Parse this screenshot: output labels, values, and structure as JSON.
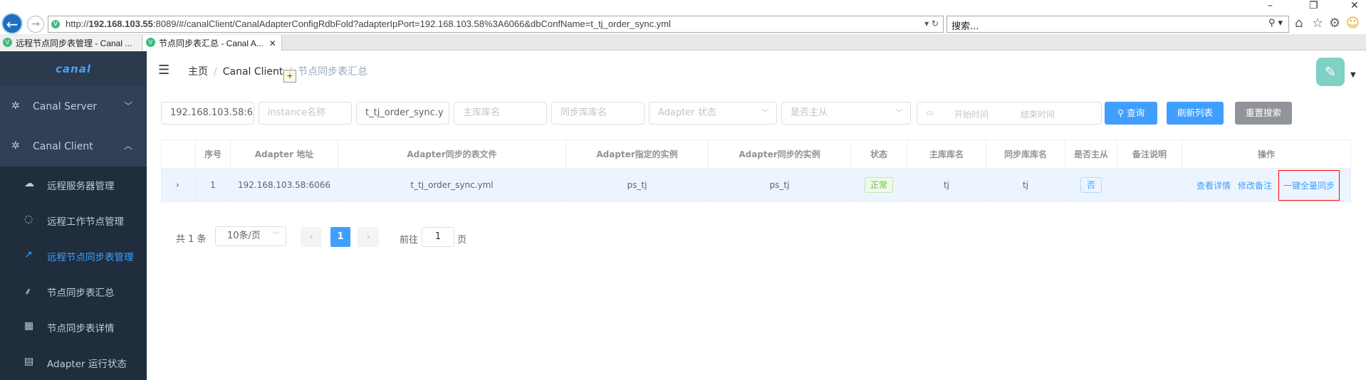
{
  "browser": {
    "url_prefix": "http://",
    "url_host": "192.168.103.55",
    "url_rest": ":8089/#/canalClient/CanalAdapterConfigRdbFold?adapterIpPort=192.168.103.58%3A6066&dbConfName=t_tj_order_sync.yml",
    "search_placeholder": "搜索...",
    "tabs": [
      {
        "label": "远程节点同步表管理 - Canal ..."
      },
      {
        "label": "节点同步表汇总 - Canal A..."
      }
    ]
  },
  "sidebar": {
    "logo": "canal",
    "menus": [
      {
        "label": "Canal Server",
        "icon": "gear-icon"
      },
      {
        "label": "Canal Client",
        "icon": "gear-icon"
      }
    ],
    "items": [
      {
        "label": "远程服务器管理",
        "icon": "cloud-icon"
      },
      {
        "label": "远程工作节点管理",
        "icon": "chat-icon"
      },
      {
        "label": "远程节点同步表管理",
        "icon": "external-link-icon"
      },
      {
        "label": "节点同步表汇总",
        "icon": "tree-icon"
      },
      {
        "label": "节点同步表详情",
        "icon": "table-icon"
      },
      {
        "label": "Adapter 运行状态",
        "icon": "document-icon"
      }
    ]
  },
  "header": {
    "breadcrumb": [
      "主页",
      "Canal Client",
      "节点同步表汇总"
    ]
  },
  "filters": {
    "adapter_ip": "192.168.103.58:6",
    "instance_ph": "instance名称",
    "conf_file": "t_tj_order_sync.y",
    "master_db_ph": "主库库名",
    "sync_db_ph": "同步库库名",
    "status_ph": "Adapter 状态",
    "is_master_ph": "是否主从",
    "start_ph": "开始时间",
    "end_ph": "结束时间",
    "query_btn": "查询",
    "refresh_btn": "刷新列表",
    "reset_btn": "重置搜索"
  },
  "table": {
    "headers": [
      "",
      "序号",
      "Adapter 地址",
      "Adapter同步的表文件",
      "Adapter指定的实例",
      "Adapter同步的实例",
      "状态",
      "主库库名",
      "同步库库名",
      "是否主从",
      "备注说明",
      "操作"
    ],
    "rows": [
      {
        "index": "1",
        "address": "192.168.103.58:6066",
        "file": "t_tj_order_sync.yml",
        "instance": "ps_tj",
        "sync_instance": "ps_tj",
        "status": "正常",
        "master_db": "tj",
        "sync_db": "tj",
        "is_master": "否",
        "remark": "",
        "act_detail": "查看详情",
        "act_edit": "修改备注",
        "act_sync": "一键全量同步"
      }
    ]
  },
  "pagination": {
    "total": "共 1 条",
    "page_size": "10条/页",
    "current": "1",
    "goto_label": "前往",
    "goto_value": "1",
    "page_label": "页"
  }
}
